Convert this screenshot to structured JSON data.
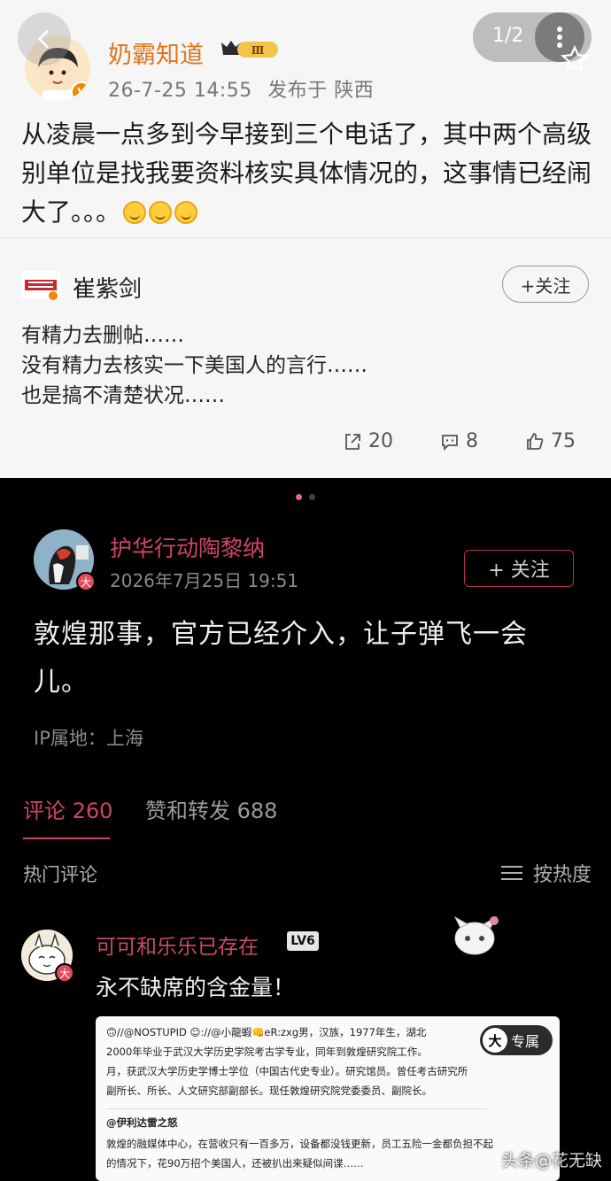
{
  "top_post": {
    "author": "奶霸知道",
    "level_badge": "Ⅲ",
    "timestamp": "26-7-25 14:55",
    "location": "发布于 陕西",
    "body": "从凌晨一点多到今早接到三个电话了，其中两个高级别单位是找我要资料核实具体情况的，这事情已经闹大了。。。",
    "pager": "1/2",
    "avatar_badge": "V"
  },
  "reply_card": {
    "author": "崔紫剑",
    "follow_label": "+关注",
    "lines": [
      "有精力去删帖……",
      "没有精力去核实一下美国人的言行……",
      "也是搞不清楚状况……"
    ],
    "shares": "20",
    "comments": "8",
    "likes": "75"
  },
  "dark_post": {
    "author": "护华行动陶黎纳",
    "timestamp": "2026年7月25日  19:51",
    "follow_label": "+ 关注",
    "body": "敦煌那事，官方已经介入，让子弹飞一会儿。",
    "ip": "IP属地：上海",
    "avatar_badge": "大",
    "tabs": {
      "comments": "评论 260",
      "likes": "赞和转发 688"
    },
    "hot_label": "热门评论",
    "sort_label": "按热度"
  },
  "hot_comment": {
    "author": "可可和乐乐已存在",
    "level": "LV6",
    "text": "永不缺席的含金量！",
    "avatar_badge": "大"
  },
  "embedded_image": {
    "lines": [
      "🙃//@NOSTUPID ☺://@小龍蝦👊eR:zxg男，汉族，1977年生，湖北",
      "2000年毕业于武汉大学历史学院考古学专业，同年到敦煌研究院工作。",
      "月，获武汉大学历史学博士学位（中国古代史专业）。研究馆员。曾任考古研究所",
      "副所长、所长、人文研究部副部长。现任敦煌研究院党委委员、副院长。",
      "@伊利达雷之怒",
      "敦煌的融媒体中心，在营收只有一百多万，设备都没钱更新，员工五险一金都负担不起",
      "的情况下，花90万招个美国人，还被扒出来疑似间谍……"
    ],
    "exclusive_badge_char": "大",
    "exclusive_badge_text": "专属"
  },
  "watermark": "头条@花无缺",
  "colors": {
    "accent_pink": "#d0446c",
    "orange_name": "#e2741a"
  }
}
